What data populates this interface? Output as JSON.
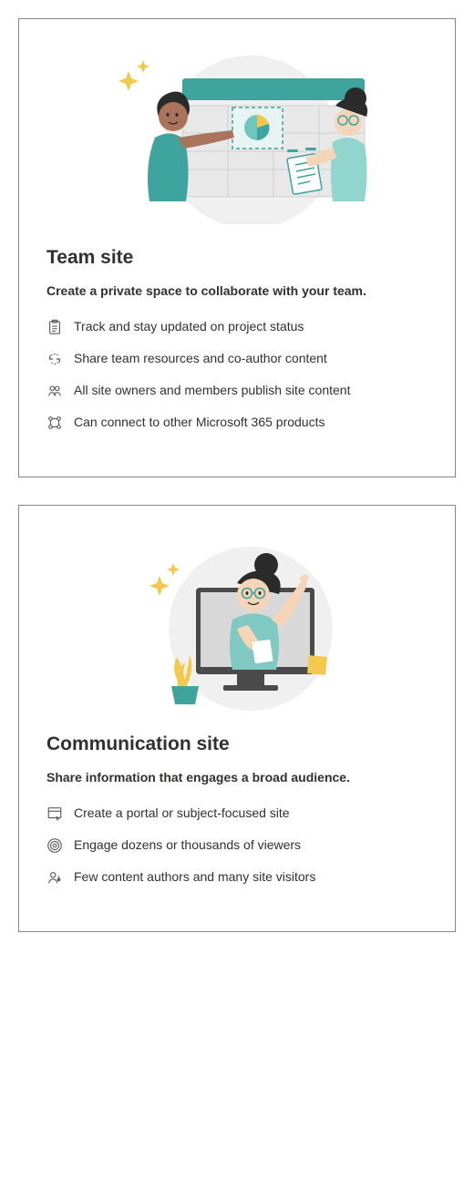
{
  "cards": [
    {
      "title": "Team site",
      "subtitle": "Create a private space to collaborate with your team.",
      "features": [
        {
          "icon": "clipboard-icon",
          "text": "Track and stay updated on project status"
        },
        {
          "icon": "sync-icon",
          "text": "Share team resources and co-author content"
        },
        {
          "icon": "people-icon",
          "text": "All site owners and members publish site content"
        },
        {
          "icon": "connect-icon",
          "text": "Can connect to other Microsoft 365 products"
        }
      ]
    },
    {
      "title": "Communication site",
      "subtitle": "Share information that engages a broad audience.",
      "features": [
        {
          "icon": "portal-icon",
          "text": "Create a portal or subject-focused site"
        },
        {
          "icon": "broadcast-icon",
          "text": "Engage dozens or thousands of viewers"
        },
        {
          "icon": "authors-icon",
          "text": "Few content authors and many site visitors"
        }
      ]
    }
  ]
}
